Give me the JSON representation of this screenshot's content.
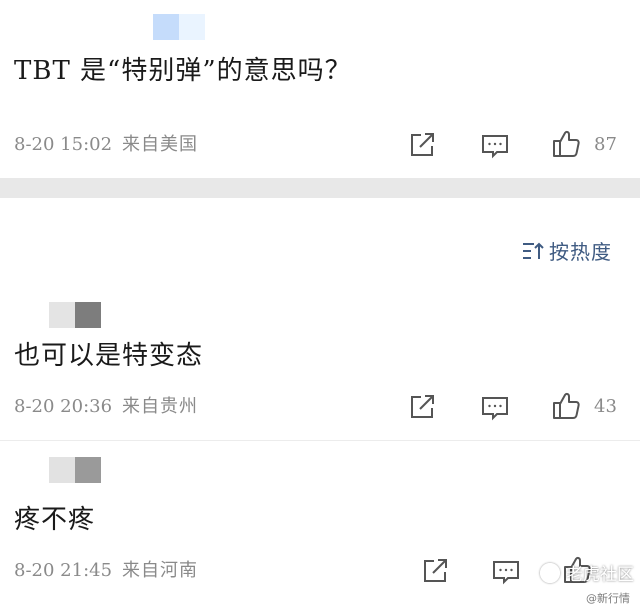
{
  "posts": [
    {
      "text": "TBT 是“特别弹”的意思吗？",
      "time": "8-20 15:02",
      "location": "来自美国",
      "likes": "87",
      "avatar_colors": [
        "#c5dcfb",
        "#eaf4ff"
      ]
    }
  ],
  "sort": {
    "label": "按热度",
    "icon": "sort-icon"
  },
  "replies": [
    {
      "text": "也可以是特变态",
      "time": "8-20 20:36",
      "location": "来自贵州",
      "likes": "43",
      "avatar_colors": [
        "#e4e4e4",
        "#7d7d7d"
      ]
    },
    {
      "text": "疼不疼",
      "time": "8-20 21:45",
      "location": "来自河南",
      "likes": "",
      "avatar_colors": [
        "#e2e2e2",
        "#9a9a9a"
      ]
    }
  ],
  "icons": {
    "share": "share-icon",
    "comment": "comment-icon",
    "like": "thumbs-up-icon"
  },
  "watermark": {
    "main": "老虎社区",
    "sub": "@新行情"
  },
  "colors": {
    "meta_gray": "#8a8a8a",
    "sort_blue": "#3f5b82",
    "separator": "#e8e8e8"
  }
}
